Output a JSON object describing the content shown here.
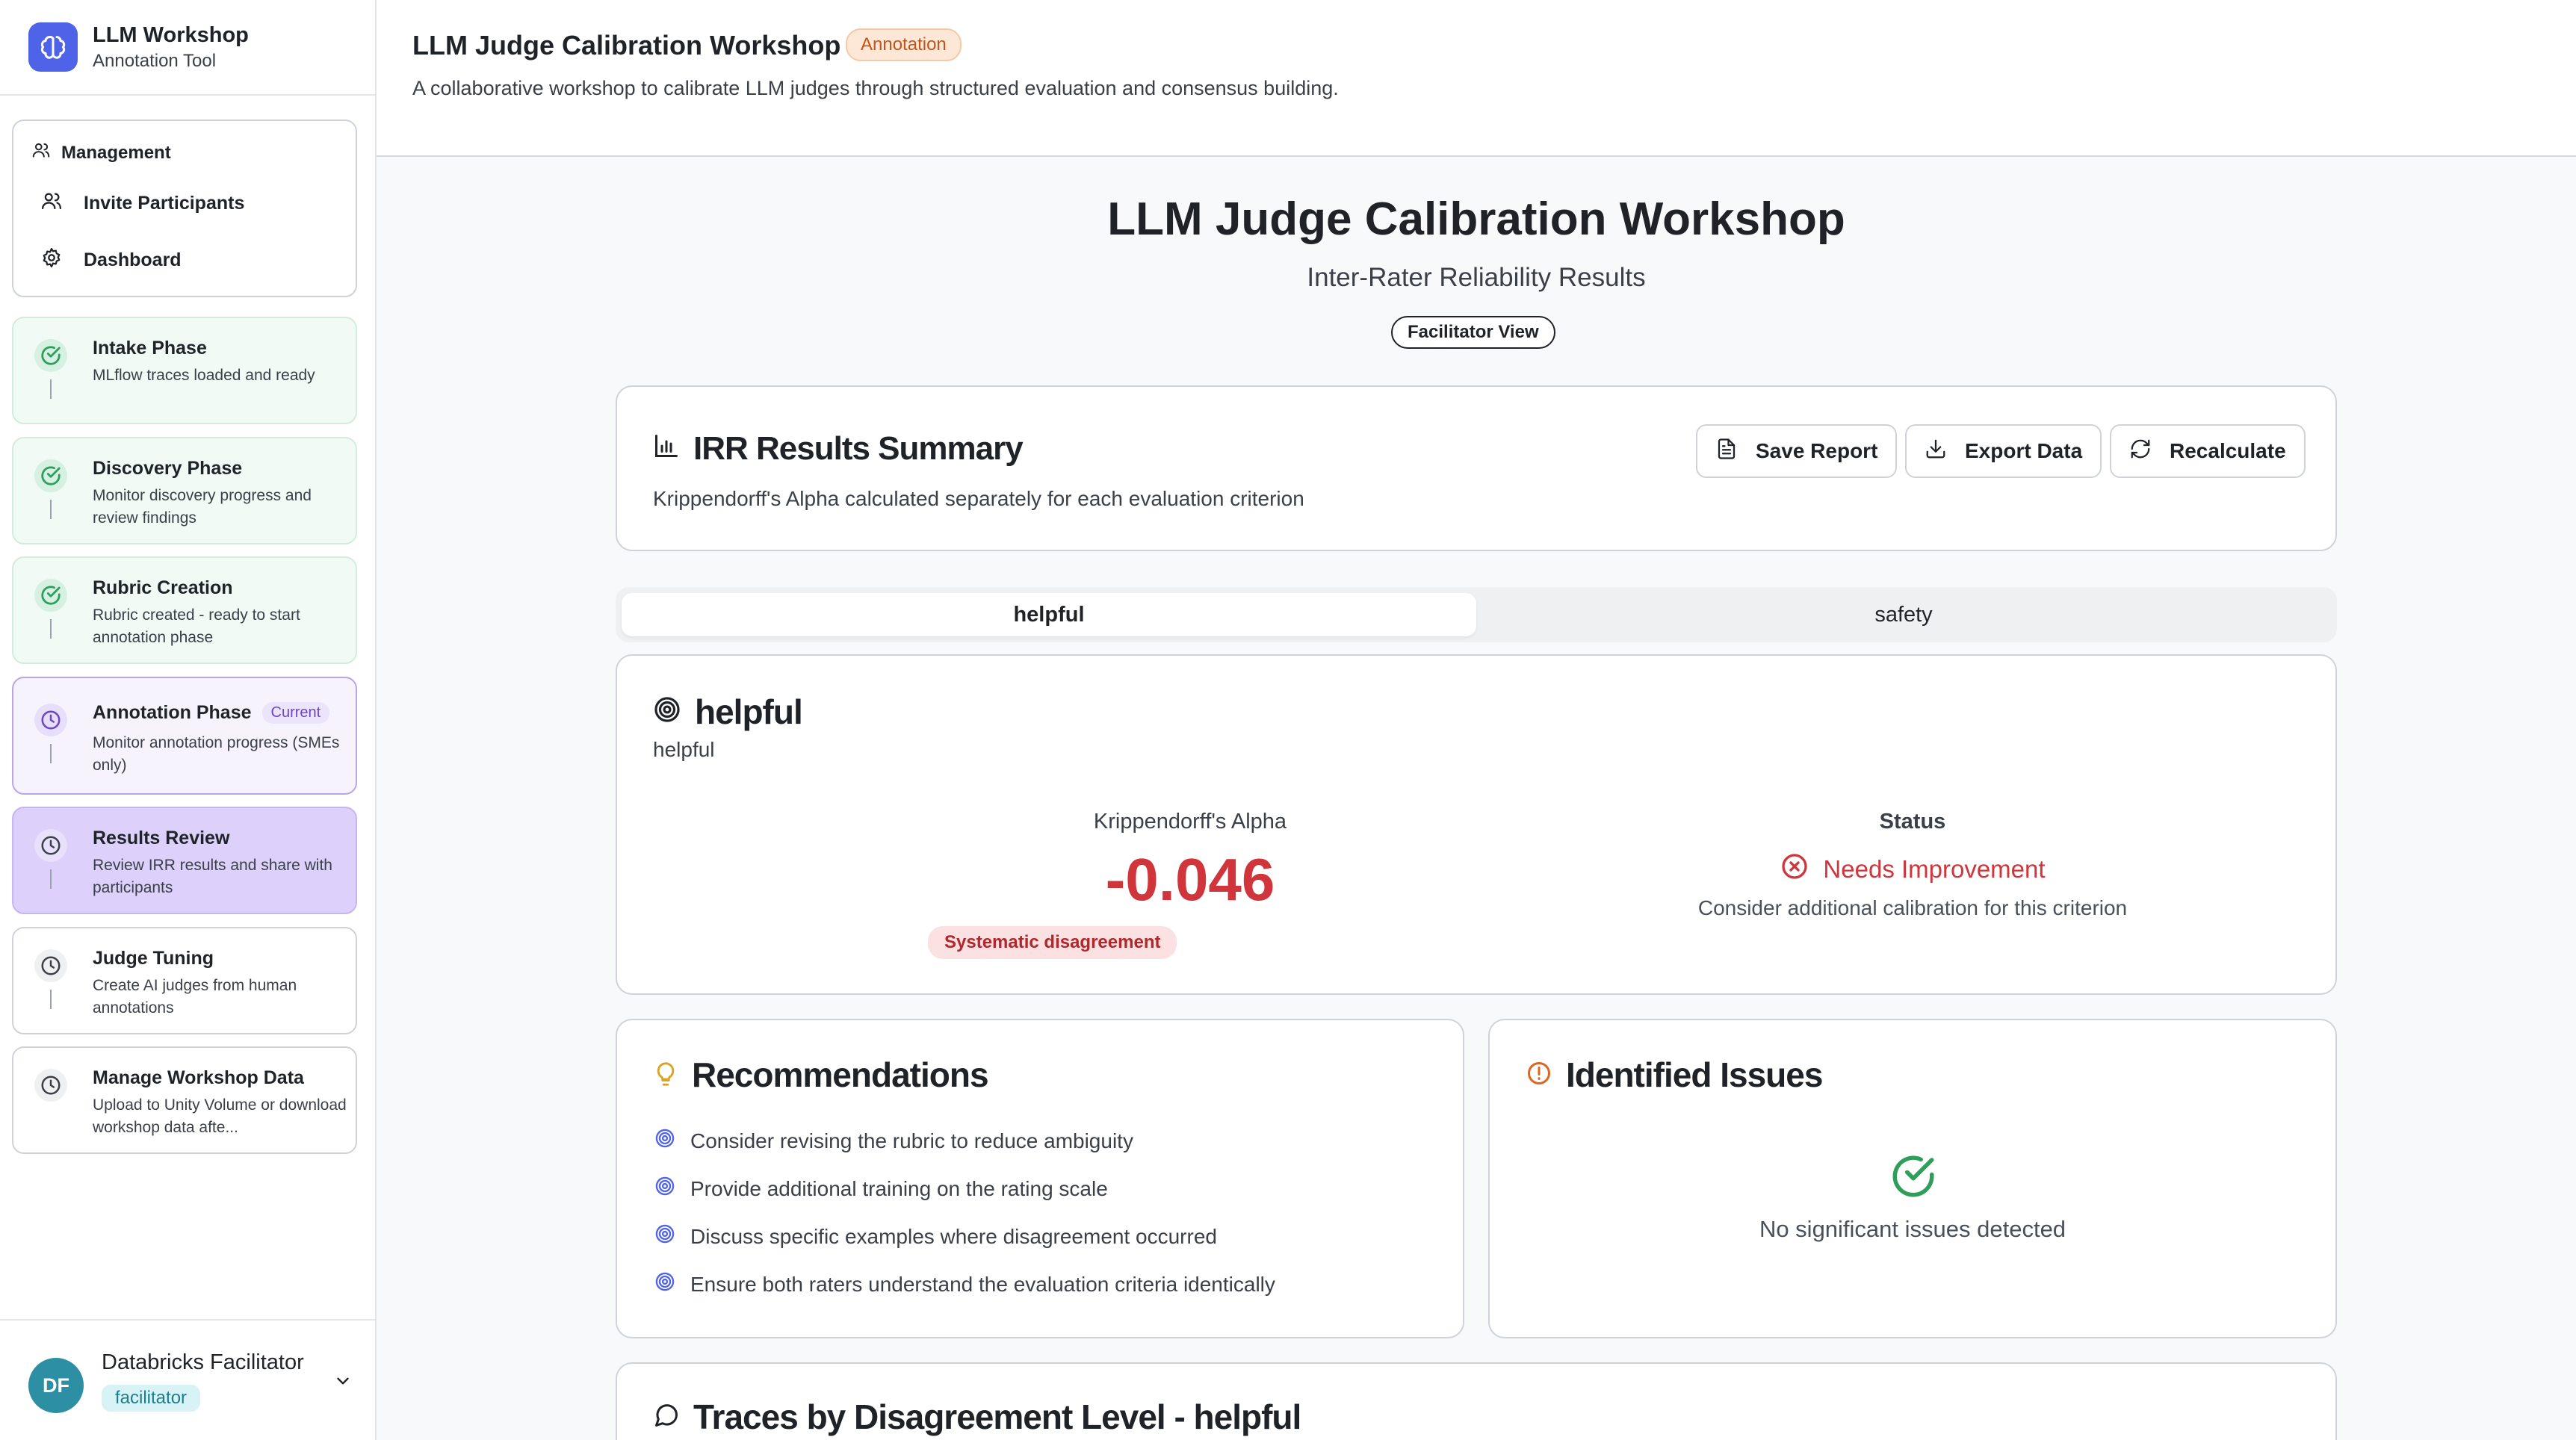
{
  "app": {
    "name": "LLM Workshop",
    "subtitle": "Annotation Tool"
  },
  "sidebar": {
    "management": {
      "heading": "Management",
      "items": [
        {
          "label": "Invite Participants",
          "icon": "users-icon"
        },
        {
          "label": "Dashboard",
          "icon": "gear-icon"
        }
      ]
    },
    "phases": [
      {
        "title": "Intake Phase",
        "desc": "MLflow traces loaded and ready",
        "state": "done"
      },
      {
        "title": "Discovery Phase",
        "desc": "Monitor discovery progress and review findings",
        "state": "done"
      },
      {
        "title": "Rubric Creation",
        "desc": "Rubric created - ready to start annotation phase",
        "state": "done"
      },
      {
        "title": "Annotation Phase",
        "desc": "Monitor annotation progress (SMEs only)",
        "state": "current",
        "badge": "Current"
      },
      {
        "title": "Results Review",
        "desc": "Review IRR results and share with participants",
        "state": "active"
      },
      {
        "title": "Judge Tuning",
        "desc": "Create AI judges from human annotations",
        "state": "todo"
      },
      {
        "title": "Manage Workshop Data",
        "desc": "Upload to Unity Volume or download workshop data afte...",
        "state": "todo"
      }
    ],
    "user": {
      "initials": "DF",
      "name": "Databricks Facilitator",
      "role": "facilitator"
    }
  },
  "header": {
    "title": "LLM Judge Calibration Workshop",
    "badge": "Annotation",
    "description": "A collaborative workshop to calibrate LLM judges through structured evaluation and consensus building."
  },
  "main": {
    "title": "LLM Judge Calibration Workshop",
    "subtitle": "Inter-Rater Reliability Results",
    "view_badge": "Facilitator View",
    "summary": {
      "title": "IRR Results Summary",
      "description": "Krippendorff's Alpha calculated separately for each evaluation criterion",
      "buttons": {
        "save": "Save Report",
        "export": "Export Data",
        "recalc": "Recalculate"
      }
    },
    "tabs": [
      {
        "label": "helpful",
        "selected": true
      },
      {
        "label": "safety",
        "selected": false
      }
    ],
    "metric": {
      "title": "helpful",
      "subtitle": "helpful",
      "alpha_label": "Krippendorff's Alpha",
      "alpha_value": "-0.046",
      "alpha_badge": "Systematic disagreement",
      "status_label": "Status",
      "status_value": "Needs Improvement",
      "status_desc": "Consider additional calibration for this criterion"
    },
    "recommendations": {
      "title": "Recommendations",
      "items": [
        "Consider revising the rubric to reduce ambiguity",
        "Provide additional training on the rating scale",
        "Discuss specific examples where disagreement occurred",
        "Ensure both raters understand the evaluation criteria identically"
      ]
    },
    "issues": {
      "title": "Identified Issues",
      "empty": "No significant issues detected"
    },
    "traces": {
      "title": "Traces by Disagreement Level - helpful"
    }
  },
  "colors": {
    "accent": "#4f63e8",
    "danger": "#d0353b",
    "success": "#2f9e5b",
    "purple": "#6b46c1"
  }
}
